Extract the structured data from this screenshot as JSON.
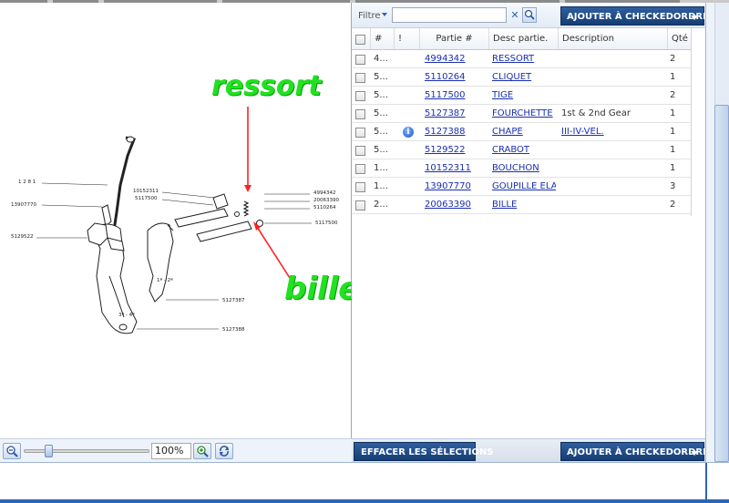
{
  "diagram": {
    "annotations": {
      "ressort": "ressort",
      "bille": "bille"
    },
    "part_labels": [
      "1 2 8 1",
      "13907770",
      "5129522",
      "10152311",
      "5117500",
      "4994342",
      "20063390",
      "5110264",
      "5117500",
      "1ª - 2ª",
      "5127387",
      "3ª - 4ª",
      "5127388"
    ],
    "arrow_color": "#ff2020"
  },
  "zoom": {
    "value": "100%",
    "level": 0.2
  },
  "toolbar": {
    "filter_label": "Filtre",
    "filter_value": "",
    "clear_glyph": "✕",
    "add_button": "AJOUTER À CHECKEDORDRE",
    "clear_selection_button": "EFFACER LES SÉLECTIONS",
    "add_button_bottom": "AJOUTER À CHECKEDORDRE"
  },
  "table": {
    "headers": {
      "num": "#",
      "flag": "!",
      "part": "Partie #",
      "desc_part": "Desc partie.",
      "description": "Description",
      "qty": "Qté"
    },
    "rows": [
      {
        "num": "4...",
        "info": false,
        "part": "4994342",
        "desc_part": "RESSORT",
        "description": "",
        "qty": "2"
      },
      {
        "num": "5...",
        "info": false,
        "part": "5110264",
        "desc_part": "CLIQUET",
        "description": "",
        "qty": "1"
      },
      {
        "num": "5...",
        "info": false,
        "part": "5117500",
        "desc_part": "TIGE",
        "description": "",
        "qty": "2"
      },
      {
        "num": "5...",
        "info": false,
        "part": "5127387",
        "desc_part": "FOURCHETTE",
        "description": "1st & 2nd Gear",
        "qty": "1"
      },
      {
        "num": "5...",
        "info": true,
        "part": "5127388",
        "desc_part": "CHAPE",
        "description": "III-IV-VEL.",
        "qty": "1"
      },
      {
        "num": "5...",
        "info": false,
        "part": "5129522",
        "desc_part": "CRABOT",
        "description": "",
        "qty": "1"
      },
      {
        "num": "1...",
        "info": false,
        "part": "10152311",
        "desc_part": "BOUCHON",
        "description": "",
        "qty": "1"
      },
      {
        "num": "1...",
        "info": false,
        "part": "13907770",
        "desc_part": "GOUPILLE ELA:",
        "description": "",
        "qty": "3"
      },
      {
        "num": "2...",
        "info": false,
        "part": "20063390",
        "desc_part": "BILLE",
        "description": "",
        "qty": "2"
      }
    ]
  },
  "icons": {
    "zoom_out": "zoom-out-icon",
    "zoom_in": "zoom-in-icon",
    "refresh": "refresh-icon",
    "search": "search-icon",
    "info": "info-icon"
  }
}
